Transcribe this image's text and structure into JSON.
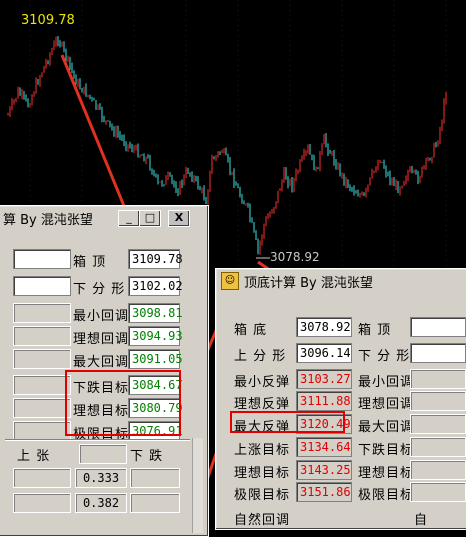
{
  "chart": {
    "high_label": "3109.78",
    "low_label": "3078.92",
    "colors": {
      "up": "#ff3030",
      "down": "#40e0e0",
      "arrow": "#e03020",
      "label": "#e8e800"
    }
  },
  "left_window": {
    "title": "算 By 混沌张望",
    "rows": [
      {
        "label": "箱    顶",
        "value": "3109.78",
        "color": "k"
      },
      {
        "label": "下 分 形",
        "value": "3102.02",
        "color": "k"
      },
      {
        "label": "最小回调",
        "value": "3098.81",
        "color": "g"
      },
      {
        "label": "理想回调",
        "value": "3094.93",
        "color": "g"
      },
      {
        "label": "最大回调",
        "value": "3091.05",
        "color": "g"
      },
      {
        "label": "下跌目标",
        "value": "3084.67",
        "color": "g"
      },
      {
        "label": "理想目标",
        "value": "3080.79",
        "color": "g"
      },
      {
        "label": "极限目标",
        "value": "3076.91",
        "color": "g"
      }
    ],
    "header_up": "上   张",
    "header_down": "下   跌",
    "fib": [
      "0.333",
      "0.382"
    ]
  },
  "right_window": {
    "title": "顶底计算 By 混沌张望",
    "left_rows": [
      {
        "label": "箱    底",
        "value": "3078.92",
        "color": "k"
      },
      {
        "label": "上 分 形",
        "value": "3096.14",
        "color": "k"
      },
      {
        "label": "最小反弹",
        "value": "3103.27",
        "color": "r"
      },
      {
        "label": "理想反弹",
        "value": "3111.88",
        "color": "r"
      },
      {
        "label": "最大反弹",
        "value": "3120.49",
        "color": "r"
      },
      {
        "label": "上涨目标",
        "value": "3134.64",
        "color": "r"
      },
      {
        "label": "理想目标",
        "value": "3143.25",
        "color": "r"
      },
      {
        "label": "极限目标",
        "value": "3151.86",
        "color": "r"
      }
    ],
    "right_rows": [
      {
        "label": "箱    顶"
      },
      {
        "label": "下 分 形"
      },
      {
        "label": "最小回调"
      },
      {
        "label": "理想回调"
      },
      {
        "label": "最大回调"
      },
      {
        "label": "下跌目标"
      },
      {
        "label": "理想目标"
      },
      {
        "label": "极限目标"
      }
    ],
    "bottom_label": "自然回调",
    "bottom_right_label": "自"
  },
  "window_buttons": {
    "minimize": "_",
    "maximize": "□",
    "close": "X"
  }
}
